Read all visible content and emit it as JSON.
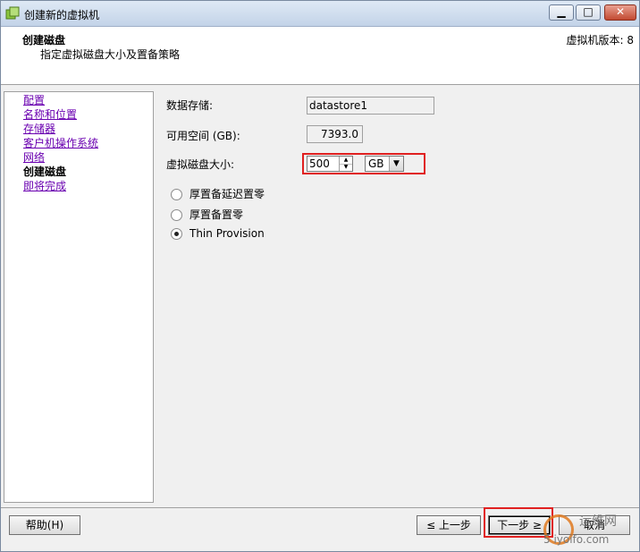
{
  "window": {
    "title": "创建新的虚拟机",
    "minimize_glyph": "▁",
    "maximize_glyph": "□",
    "close_glyph": "✕"
  },
  "header": {
    "title": "创建磁盘",
    "subtitle": "指定虚拟磁盘大小及置备策略",
    "version": "虚拟机版本: 8"
  },
  "nav": {
    "items": [
      {
        "label": "配置"
      },
      {
        "label": "名称和位置"
      },
      {
        "label": "存储器"
      },
      {
        "label": "客户机操作系统"
      },
      {
        "label": "网络"
      },
      {
        "label": "创建磁盘"
      },
      {
        "label": "即将完成"
      }
    ],
    "current_index": 5
  },
  "form": {
    "datastore_label": "数据存储:",
    "datastore_value": "datastore1",
    "free_space_label": "可用空间 (GB):",
    "free_space_value": "7393.0",
    "disk_size_label": "虚拟磁盘大小:",
    "disk_size_value": "500",
    "disk_size_unit": "GB",
    "spin_up": "▲",
    "spin_down": "▼",
    "dropdown_arrow": "▼",
    "provisioning_options": [
      {
        "label": "厚置备延迟置零",
        "checked": false
      },
      {
        "label": "厚置备置零",
        "checked": false
      },
      {
        "label": "Thin Provision",
        "checked": true
      }
    ]
  },
  "footer": {
    "help_label": "帮助(H)",
    "back_label": "≤ 上一步",
    "next_label": "下一步 ≥",
    "cancel_label": "取消"
  },
  "watermark": {
    "name": "运维网",
    "url": "5 iyoifo.com"
  },
  "colors": {
    "highlight": "#e02020",
    "link": "#6a00b0"
  }
}
